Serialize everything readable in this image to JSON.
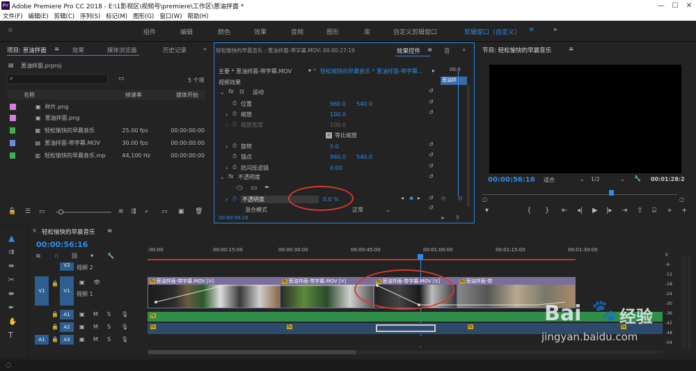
{
  "window": {
    "title": "Adobe Premiere Pro CC 2018 - E:\\1影视区\\视频号\\premiere\\工作区\\葱油拌面 *",
    "controls": [
      "—",
      "☐",
      "✕"
    ]
  },
  "menu": [
    "文件(F)",
    "编辑(E)",
    "剪辑(C)",
    "序列(S)",
    "标记(M)",
    "图形(G)",
    "窗口(W)",
    "帮助(H)"
  ],
  "workspaces": [
    {
      "label": "组件",
      "active": false
    },
    {
      "label": "编辑",
      "active": false
    },
    {
      "label": "颜色",
      "active": false
    },
    {
      "label": "效果",
      "active": false
    },
    {
      "label": "音频",
      "active": false
    },
    {
      "label": "图形",
      "active": false
    },
    {
      "label": "库",
      "active": false
    },
    {
      "label": "自定义剪辑窗口",
      "active": false
    },
    {
      "label": "剪辑窗口（自定义）",
      "active": true
    }
  ],
  "project": {
    "tabs": [
      "项目: 葱油拌面",
      "效果",
      "媒体浏览器",
      "历史记录"
    ],
    "file": "葱油拌面.prproj",
    "item_count": "5 个项",
    "columns": [
      "名称",
      "帧速率",
      "媒体开始"
    ],
    "items": [
      {
        "name": "样片.png",
        "fps": "",
        "start": "",
        "color": "#d67fd6",
        "icon": "image-icon"
      },
      {
        "name": "葱油拌面.png",
        "fps": "",
        "start": "",
        "color": "#d67fd6",
        "icon": "image-icon"
      },
      {
        "name": "轻松愉快的早晨音乐",
        "fps": "25.00 fps",
        "start": "00:00:00:00",
        "color": "#3fb24e",
        "icon": "sequence-icon"
      },
      {
        "name": "葱油拌面-带字幕.MOV",
        "fps": "30.00 fps",
        "start": "00:00:00:00",
        "color": "#6a8fd0",
        "icon": "video-icon"
      },
      {
        "name": "轻松愉快的早晨音乐.mp",
        "fps": "44,100 Hz",
        "start": "00:00:00:00",
        "color": "#3fb24e",
        "icon": "audio-icon"
      }
    ]
  },
  "effects": {
    "header": "轻松愉快的早晨音乐 : 葱油拌面-带字幕.MOV: 00:00:27:19",
    "tab_active": "效果控件",
    "tab_next": "音",
    "master": "主要 * 葱油拌面-带字幕.MOV",
    "seq_clip": "轻松愉快的早晨音乐 * 葱油拌面-带字幕...",
    "time_top": "00:0",
    "mini_clip": "葱油拌",
    "section_video": "视频效果",
    "motion": "运动",
    "params": [
      {
        "name": "位置",
        "v1": "960.0",
        "v2": "540.0"
      },
      {
        "name": "缩放",
        "v1": "100.0",
        "v2": ""
      },
      {
        "name": "缩放宽度",
        "v1": "100.0",
        "v2": "",
        "disabled": true
      },
      {
        "name": "旋转",
        "v1": "0.0",
        "v2": ""
      },
      {
        "name": "锚点",
        "v1": "960.0",
        "v2": "540.0"
      },
      {
        "name": "防闪烁滤镜",
        "v1": "0.00",
        "v2": ""
      }
    ],
    "uniform_scale": "等比缩放",
    "opacity_section": "不透明度",
    "opacity_label": "不透明度",
    "opacity_value": "0.0 %",
    "blend_label": "混合模式",
    "blend_value": "正常",
    "footer_time": "00:00:56:16"
  },
  "program": {
    "title": "节目: 轻松愉快的早晨音乐",
    "timecode": "00:00:56:16",
    "fit": "适合",
    "resolution": "1/2",
    "duration": "00:01:28:2"
  },
  "timeline": {
    "tab": "轻松愉快的早晨音乐",
    "timecode": "00:00:56:16",
    "ruler": [
      ":00:00",
      "00:00:15:00",
      "00:00:30:00",
      "00:00:45:00",
      "00:01:00:00",
      "00:01:15:00",
      "00:01:30:00"
    ],
    "tracks": [
      {
        "id": "V2",
        "name": "视频 2"
      },
      {
        "id": "V1",
        "name": "视频 1",
        "src": "V1"
      },
      {
        "id": "A1",
        "name": ""
      },
      {
        "id": "A2",
        "name": ""
      },
      {
        "id": "A3",
        "name": "",
        "src": "A1"
      }
    ],
    "clip_labels": [
      "葱油拌面-带字幕.MOV [V]",
      "葱油拌面-带字幕.MOV [V]",
      "葱油拌面-带字幕.MOV [V]",
      "葱油拌面-带"
    ],
    "audio_levels": [
      "0",
      "-6",
      "-12",
      "-18",
      "-24",
      "-30",
      "-36",
      "-42",
      "-48",
      "-54"
    ]
  },
  "watermark": {
    "brand": "Bai",
    "brand2": "经验",
    "url": "jingyan.baidu.com"
  },
  "colors": {
    "accent": "#2d8ceb",
    "annotation": "#d8382f",
    "clip": "#7a6f9a",
    "audio": "#3fb24e"
  }
}
